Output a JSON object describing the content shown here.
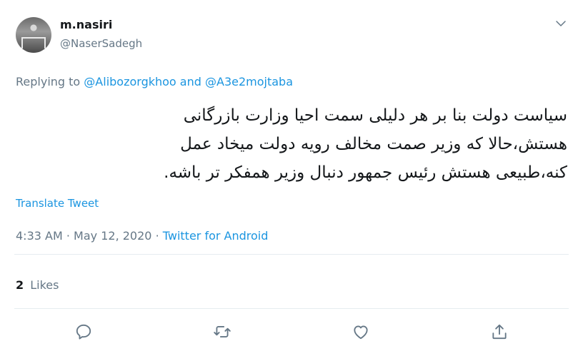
{
  "author": {
    "display_name": "m.nasiri",
    "handle": "@NaserSadegh"
  },
  "reply": {
    "prefix": "Replying to",
    "mention1": "@Alibozorgkhoo",
    "joiner": "and",
    "mention2": "@A3e2mojtaba"
  },
  "tweet": {
    "line1": "سیاست دولت بنا بر هر دلیلی سمت احیا وزارت بازرگانی",
    "line2": "هستش،حالا که وزیر صمت مخالف رویه دولت میخاد عمل",
    "line3": "کنه،طبیعی هستش رئیس جمهور دنبال وزیر همفکر تر باشه."
  },
  "translate_label": "Translate Tweet",
  "meta": {
    "time": "4:33 AM",
    "sep1": "·",
    "date": "May 12, 2020",
    "sep2": "·",
    "source": "Twitter for Android"
  },
  "stats": {
    "likes_count": "2",
    "likes_label": "Likes"
  },
  "icons": {
    "menu": "chevron-down-icon",
    "reply": "reply-icon",
    "retweet": "retweet-icon",
    "like": "heart-icon",
    "share": "share-icon"
  },
  "colors": {
    "link": "#1b95e0",
    "secondary": "#657786",
    "primary_text": "#14171a",
    "divider": "#e6ecf0"
  }
}
